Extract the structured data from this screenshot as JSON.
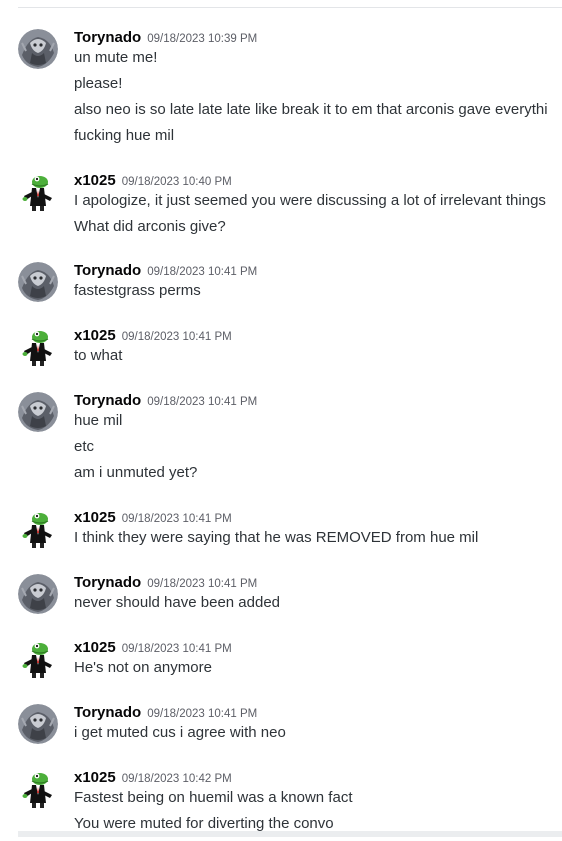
{
  "messages": [
    {
      "username": "Torynado",
      "timestamp": "09/18/2023 10:39 PM",
      "avatar_icon": "torynado-avatar-icon",
      "lines": [
        "un mute me!",
        "please!",
        "also neo is so late late late like break it to em that arconis gave everythi",
        "fucking hue mil"
      ]
    },
    {
      "username": "x1025",
      "timestamp": "09/18/2023 10:40 PM",
      "avatar_icon": "frog-avatar-icon",
      "lines": [
        "I apologize, it just seemed you were discussing a lot of irrelevant things",
        "What did arconis give?"
      ]
    },
    {
      "username": "Torynado",
      "timestamp": "09/18/2023 10:41 PM",
      "avatar_icon": "torynado-avatar-icon",
      "lines": [
        "fastestgrass perms"
      ]
    },
    {
      "username": "x1025",
      "timestamp": "09/18/2023 10:41 PM",
      "avatar_icon": "frog-avatar-icon",
      "lines": [
        "to what"
      ]
    },
    {
      "username": "Torynado",
      "timestamp": "09/18/2023 10:41 PM",
      "avatar_icon": "torynado-avatar-icon",
      "lines": [
        "hue mil",
        "etc",
        "am i unmuted yet?"
      ]
    },
    {
      "username": "x1025",
      "timestamp": "09/18/2023 10:41 PM",
      "avatar_icon": "frog-avatar-icon",
      "lines": [
        "I think they were saying that he was REMOVED from hue mil"
      ]
    },
    {
      "username": "Torynado",
      "timestamp": "09/18/2023 10:41 PM",
      "avatar_icon": "torynado-avatar-icon",
      "lines": [
        "never should have been added"
      ]
    },
    {
      "username": "x1025",
      "timestamp": "09/18/2023 10:41 PM",
      "avatar_icon": "frog-avatar-icon",
      "lines": [
        "He's not on anymore"
      ]
    },
    {
      "username": "Torynado",
      "timestamp": "09/18/2023 10:41 PM",
      "avatar_icon": "torynado-avatar-icon",
      "lines": [
        "i get muted cus i agree with neo"
      ]
    },
    {
      "username": "x1025",
      "timestamp": "09/18/2023 10:42 PM",
      "avatar_icon": "frog-avatar-icon",
      "lines": [
        "Fastest being on huemil was a known fact",
        "You were muted for diverting the convo"
      ]
    }
  ],
  "colors": {
    "username": "#060607",
    "timestamp": "#5c5e66",
    "message_text": "#2e3338",
    "frog_green": "#4caf3a",
    "torynado_bg": "#6b6f7a"
  }
}
